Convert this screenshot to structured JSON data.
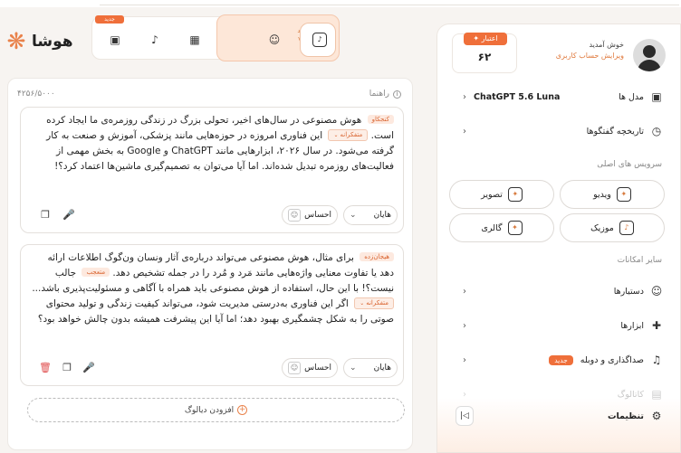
{
  "app": {
    "name": "هوشا"
  },
  "tray": {
    "badge": "جدید",
    "active_text": "ند\nV"
  },
  "editor": {
    "guide_label": "راهنما",
    "char_count": "۴۲۵۶/۵۰۰۰",
    "add_dialog_label": "افزودن دیالوگ",
    "messages": [
      {
        "segments": [
          {
            "emotion": "کنجکاو",
            "text": "هوش مصنوعی در سال‌های اخیر، تحولی بزرگ در زندگی روزمره‌ی ما ایجاد کرده است."
          },
          {
            "emotion": "متفکرانه",
            "text": "این فناوری امروزه در حوزه‌هایی مانند پزشکی، آموزش و صنعت به کار گرفته می‌شود. در سال ۲۰۲۶، ابزارهایی مانند ChatGPT و Google به بخش مهمی از فعالیت‌های روزمره تبدیل شده‌اند. اما آیا می‌توان به تصمیم‌گیری ماشین‌ها اعتماد کرد؟!"
          }
        ],
        "voice": "هایان",
        "emotion_select": "احساس"
      },
      {
        "segments": [
          {
            "emotion": "هیجان‌زده",
            "text": "برای مثال، هوش مصنوعی می‌تواند درباره‌ی آثار ونسان ون‌گوگ اطلاعات ارائه دهد یا تفاوت معنایی واژه‌هایی مانند مَرد و مُرد را در جمله تشخیص دهد."
          },
          {
            "emotion": "متعجب",
            "text": "جالب نیست؟! با این حال، استفاده از هوش مصنوعی باید همراه با آگاهی و مسئولیت‌پذیری باشد..."
          },
          {
            "emotion": "متفکرانه",
            "text": "اگر این فناوری به‌درستی مدیریت شود، می‌تواند کیفیت زندگی و تولید محتوای صوتی را به شکل چشمگیری بهبود دهد؛ اما آیا این پیشرفت همیشه بدون چالش خواهد بود؟"
          }
        ],
        "voice": "هایان",
        "emotion_select": "احساس"
      }
    ]
  },
  "sidebar": {
    "welcome": "خوش آمدید",
    "edit_account": "ویرایش حساب کاربری",
    "credit_label": "اعتبار",
    "credit_value": "۶۲",
    "model_label": "مدل ها",
    "model_value": "ChatGPT 5.6 Luna",
    "history_label": "تاریخچه گفتگوها",
    "main_services_title": "سرویس های اصلی",
    "services": {
      "video": "ویدیو",
      "image": "تصویر",
      "music": "موزیک",
      "gallery": "گالری"
    },
    "other_title": "سایر امکانات",
    "assistants": "دستیارها",
    "tools": "ابزارها",
    "dubbing": "صداگذاری و دوبله",
    "new_badge": "جدید",
    "faded_item": "کاتالوگ",
    "settings": "تنظیمات"
  },
  "colors": {
    "accent": "#ef6f3a",
    "accent_soft": "#fde7d8"
  }
}
